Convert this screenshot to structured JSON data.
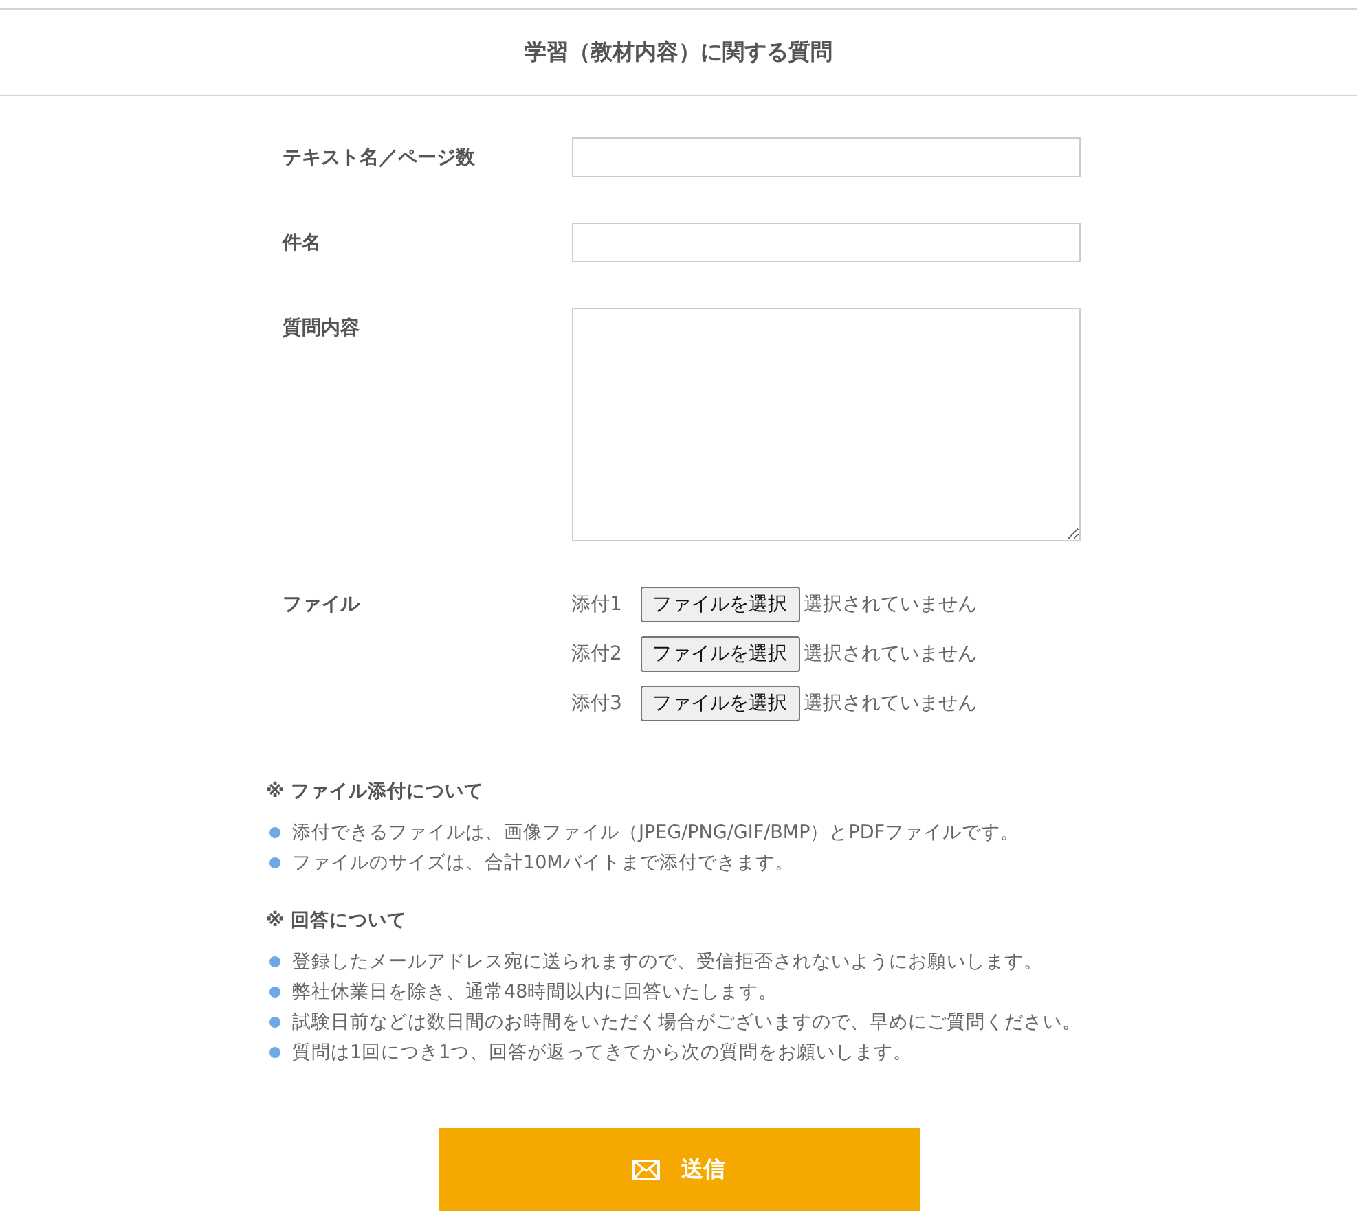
{
  "title": "学習（教材内容）に関する質問",
  "fields": [
    {
      "label": "テキスト名／ページ数",
      "kind": "text"
    },
    {
      "label": "件名",
      "kind": "text"
    },
    {
      "label": "質問内容",
      "kind": "textarea"
    }
  ],
  "file_section": {
    "label": "ファイル",
    "attachments": [
      {
        "label": "添付1",
        "button": "ファイルを選択",
        "status": "選択されていません"
      },
      {
        "label": "添付2",
        "button": "ファイルを選択",
        "status": "選択されていません"
      },
      {
        "label": "添付3",
        "button": "ファイルを選択",
        "status": "選択されていません"
      }
    ]
  },
  "notes": [
    {
      "heading": "※ ファイル添付について",
      "items": [
        "添付できるファイルは、画像ファイル（JPEG/PNG/GIF/BMP）とPDFファイルです。",
        "ファイルのサイズは、合計10Mバイトまで添付できます。"
      ]
    },
    {
      "heading": "※ 回答について",
      "items": [
        "登録したメールアドレス宛に送られますので、受信拒否されないようにお願いします。",
        "弊社休業日を除き、通常48時間以内に回答いたします。",
        "試験日前などは数日間のお時間をいただく場合がございますので、早めにご質問ください。",
        "質問は1回につき1つ、回答が返ってきてから次の質問をお願いします。"
      ]
    }
  ],
  "submit_button": {
    "label": "送信"
  }
}
